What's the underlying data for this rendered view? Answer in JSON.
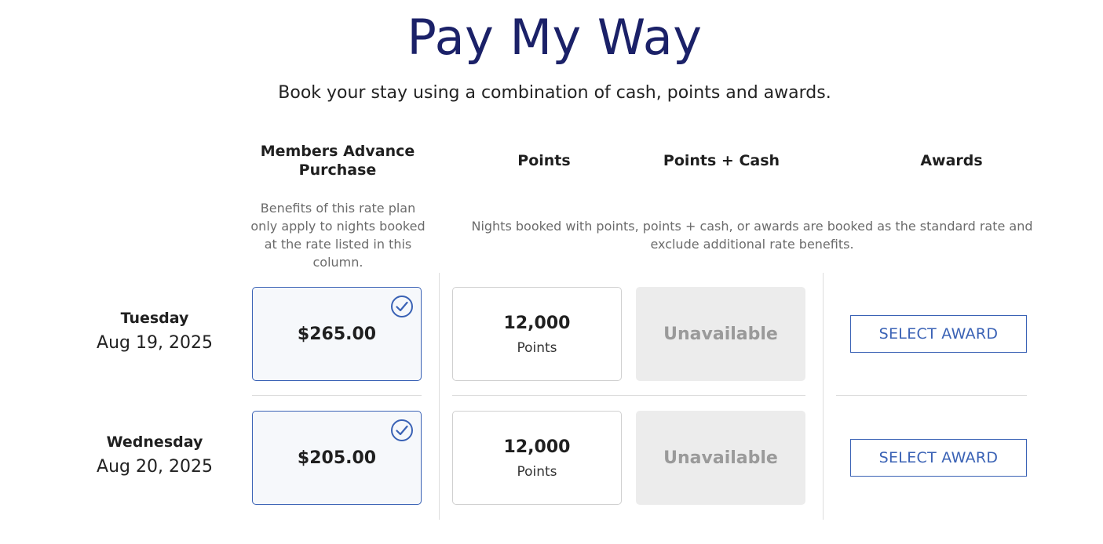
{
  "header": {
    "title": "Pay My Way",
    "subtitle": "Book your stay using a combination of cash, points and awards."
  },
  "columns": {
    "members_advance": "Members Advance Purchase",
    "points": "Points",
    "points_cash": "Points + Cash",
    "awards": "Awards"
  },
  "notes": {
    "rate_plan": "Benefits of this rate plan only apply to nights booked at the rate listed in this column.",
    "standard_rate": "Nights booked with points, points + cash, or awards are booked as the standard rate and exclude additional rate benefits."
  },
  "rows": [
    {
      "day": "Tuesday",
      "date": "Aug 19, 2025",
      "rate": "$265.00",
      "rate_selected": true,
      "points_value": "12,000",
      "points_label": "Points",
      "points_cash": "Unavailable",
      "award_button": "SELECT AWARD"
    },
    {
      "day": "Wednesday",
      "date": "Aug 20, 2025",
      "rate": "$205.00",
      "rate_selected": true,
      "points_value": "12,000",
      "points_label": "Points",
      "points_cash": "Unavailable",
      "award_button": "SELECT AWARD"
    }
  ],
  "icons": {
    "selected": "check-circle-icon"
  },
  "colors": {
    "title": "#1b2168",
    "accent": "#3a62b5",
    "unavailable_bg": "#ececec",
    "unavailable_text": "#9a9a9a"
  }
}
